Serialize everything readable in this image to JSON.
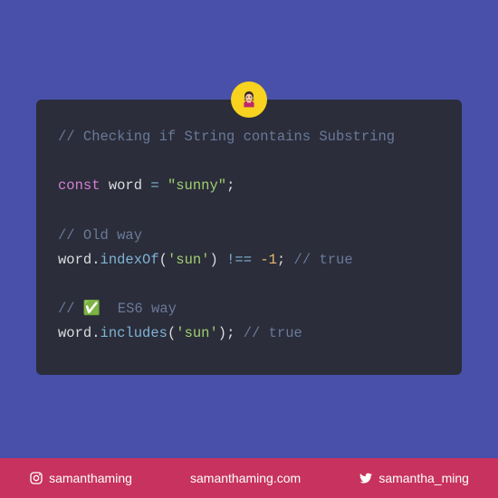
{
  "code": {
    "title_comment": "// Checking if String contains Substring",
    "const_kw": "const",
    "var_name": "word",
    "equals": " = ",
    "string_value": "\"sunny\"",
    "semicolon": ";",
    "old_way_comment": "// Old way",
    "word1": "word",
    "dot1": ".",
    "indexOf": "indexOf",
    "openp1": "(",
    "arg1": "'sun'",
    "closep1": ")",
    "neq": " !== ",
    "minus1": "-1",
    "semi2": ";",
    "true1": " // true",
    "es6_comment": "// ✅  ES6 way",
    "word2": "word",
    "dot2": ".",
    "includes": "includes",
    "openp2": "(",
    "arg2": "'sun'",
    "closep2": ")",
    "semi3": ";",
    "true2": " // true"
  },
  "footer": {
    "instagram": "samanthaming",
    "website": "samanthaming.com",
    "twitter": "samantha_ming"
  }
}
